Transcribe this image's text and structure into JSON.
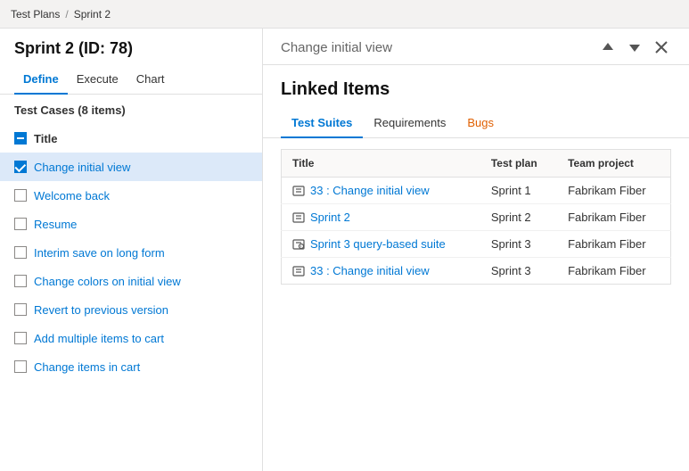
{
  "breadcrumb": {
    "part1": "Test Plans",
    "separator": "/",
    "part2": "Sprint 2"
  },
  "sprint": {
    "title": "Sprint 2 (ID: 78)"
  },
  "tabs": [
    {
      "label": "Define",
      "active": true
    },
    {
      "label": "Execute",
      "active": false
    },
    {
      "label": "Chart",
      "active": false
    }
  ],
  "testCasesHeader": "Test Cases (8 items)",
  "testCases": [
    {
      "id": "tc-title",
      "label": "Title",
      "type": "title",
      "checked": "indeterminate",
      "selected": false
    },
    {
      "id": "tc-1",
      "label": "Change initial view",
      "type": "item",
      "checked": "checked",
      "selected": true
    },
    {
      "id": "tc-2",
      "label": "Welcome back",
      "type": "item",
      "checked": "unchecked",
      "selected": false
    },
    {
      "id": "tc-3",
      "label": "Resume",
      "type": "item",
      "checked": "unchecked",
      "selected": false
    },
    {
      "id": "tc-4",
      "label": "Interim save on long form",
      "type": "item",
      "checked": "unchecked",
      "selected": false
    },
    {
      "id": "tc-5",
      "label": "Change colors on initial view",
      "type": "item",
      "checked": "unchecked",
      "selected": false
    },
    {
      "id": "tc-6",
      "label": "Revert to previous version",
      "type": "item",
      "checked": "unchecked",
      "selected": false
    },
    {
      "id": "tc-7",
      "label": "Add multiple items to cart",
      "type": "item",
      "checked": "unchecked",
      "selected": false
    },
    {
      "id": "tc-8",
      "label": "Change items in cart",
      "type": "item",
      "checked": "unchecked",
      "selected": false
    }
  ],
  "rightPanel": {
    "title": "Change initial view",
    "linkedItemsTitle": "Linked Items",
    "upIcon": "↑",
    "downIcon": "↓",
    "closeIcon": "✕"
  },
  "linkedTabs": [
    {
      "label": "Test Suites",
      "active": true
    },
    {
      "label": "Requirements",
      "active": false
    },
    {
      "label": "Bugs",
      "active": false
    }
  ],
  "tableHeaders": [
    "Title",
    "Test plan",
    "Team project"
  ],
  "tableRows": [
    {
      "title": "33 : Change initial view",
      "iconType": "suite",
      "testPlan": "Sprint 1",
      "teamProject": "Fabrikam Fiber"
    },
    {
      "title": "Sprint 2",
      "iconType": "suite",
      "testPlan": "Sprint 2",
      "teamProject": "Fabrikam Fiber"
    },
    {
      "title": "Sprint 3 query-based suite",
      "iconType": "query-suite",
      "testPlan": "Sprint 3",
      "teamProject": "Fabrikam Fiber"
    },
    {
      "title": "33 : Change initial view",
      "iconType": "suite",
      "testPlan": "Sprint 3",
      "teamProject": "Fabrikam Fiber"
    }
  ]
}
